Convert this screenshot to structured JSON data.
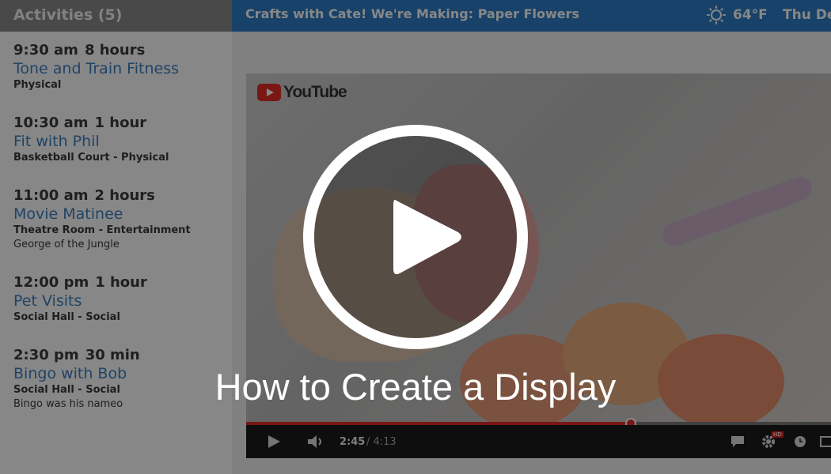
{
  "sidebar": {
    "header": "Activities (5)",
    "activities": [
      {
        "time": "9:30 am",
        "duration": "8 hours",
        "title": "Tone and Train Fitness",
        "location": "Physical",
        "note": ""
      },
      {
        "time": "10:30 am",
        "duration": "1 hour",
        "title": "Fit with Phil",
        "location": "Basketball Court - Physical",
        "note": ""
      },
      {
        "time": "11:00 am",
        "duration": "2 hours",
        "title": "Movie Matinee",
        "location": "Theatre Room - Entertainment",
        "note": "George of the Jungle"
      },
      {
        "time": "12:00 pm",
        "duration": "1 hour",
        "title": "Pet Visits",
        "location": "Social Hall - Social",
        "note": ""
      },
      {
        "time": "2:30 pm",
        "duration": "30 min",
        "title": "Bingo with Bob",
        "location": "Social Hall - Social",
        "note": "Bingo was his nameo"
      }
    ]
  },
  "topbar": {
    "title": "Crafts with Cate!  We're Making: Paper Flowers",
    "weather_icon": "sun-icon",
    "temperature": "64°F",
    "date": "Thu De"
  },
  "video": {
    "brand": "YouTube",
    "time_current": "2:45",
    "time_separator_total": "/ 4:13",
    "hd_badge": "HD",
    "progress_fraction": 0.657
  },
  "overlay": {
    "title": "How to Create a Display"
  },
  "colors": {
    "accent": "#2f7ec7",
    "link": "#3e7fc0",
    "youtube_red": "#e52d27"
  }
}
